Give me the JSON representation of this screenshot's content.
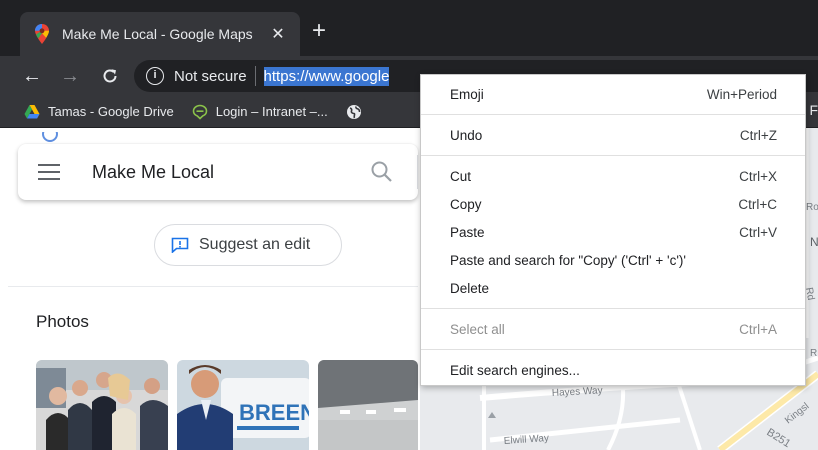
{
  "tab": {
    "title": "Make Me Local - Google Maps",
    "close": "✕",
    "new_tab": "+"
  },
  "toolbar": {
    "back": "←",
    "forward": "→",
    "reload": "C",
    "security_text": "Not secure",
    "url": "https://www.google"
  },
  "bookmarks": {
    "items": [
      {
        "label": "Tamas - Google Drive"
      },
      {
        "label": "Login – Intranet –..."
      }
    ],
    "overflow": "F"
  },
  "search": {
    "query": "Make Me Local"
  },
  "suggest_edit": {
    "label": "Suggest an edit"
  },
  "photos": {
    "heading": "Photos",
    "sign_text": "BREEN"
  },
  "map": {
    "labels": [
      "Hayes Way",
      "Elwill Way",
      "B251",
      "Kingsl",
      "Ro",
      "Rd",
      "N",
      "R"
    ]
  },
  "context_menu": {
    "items": [
      {
        "label": "Emoji",
        "shortcut": "Win+Period"
      },
      {
        "label": "Undo",
        "shortcut": "Ctrl+Z"
      },
      {
        "label": "Cut",
        "shortcut": "Ctrl+X"
      },
      {
        "label": "Copy",
        "shortcut": "Ctrl+C"
      },
      {
        "label": "Paste",
        "shortcut": "Ctrl+V"
      },
      {
        "label": "Paste and search for \"Copy' ('Ctrl' + 'c')'",
        "shortcut": ""
      },
      {
        "label": "Delete",
        "shortcut": ""
      },
      {
        "label": "Select all",
        "shortcut": "Ctrl+A"
      },
      {
        "label": "Edit search engines...",
        "shortcut": ""
      }
    ]
  },
  "colors": {
    "chrome_dark": "#202124",
    "chrome_toolbar": "#35363a",
    "url_highlight": "#3b76d1",
    "maps_pin_red": "#ea4335",
    "drive_yellow": "#fbbc04",
    "drive_green": "#34a853",
    "drive_blue": "#4285f4",
    "intranet_green": "#8bc34a"
  }
}
